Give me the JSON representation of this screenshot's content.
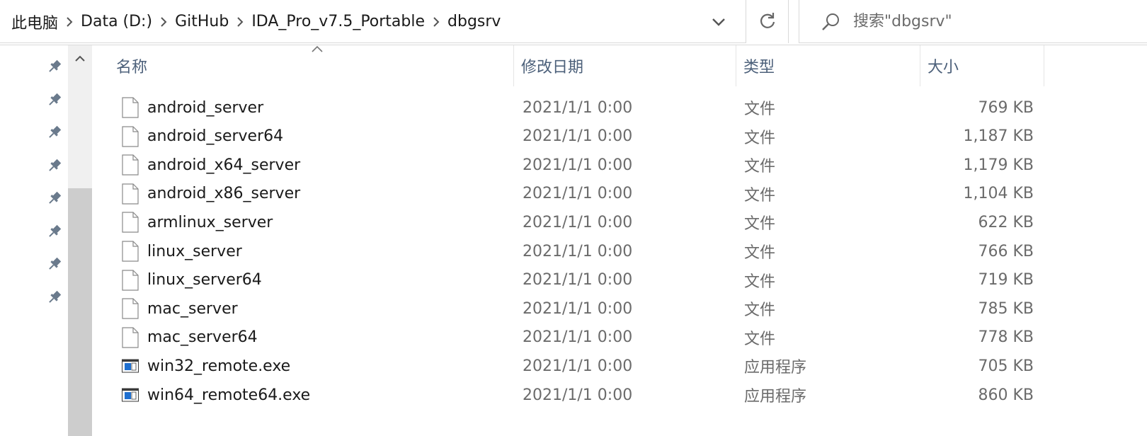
{
  "breadcrumb": [
    "此电脑",
    "Data (D:)",
    "GitHub",
    "IDA_Pro_v7.5_Portable",
    "dbgsrv"
  ],
  "search": {
    "placeholder": "搜索\"dbgsrv\""
  },
  "columns": {
    "name": "名称",
    "date": "修改日期",
    "type": "类型",
    "size": "大小"
  },
  "files": [
    {
      "name": "android_server",
      "date": "2021/1/1 0:00",
      "type": "文件",
      "size": "769 KB",
      "icon": "file-icon"
    },
    {
      "name": "android_server64",
      "date": "2021/1/1 0:00",
      "type": "文件",
      "size": "1,187 KB",
      "icon": "file-icon"
    },
    {
      "name": "android_x64_server",
      "date": "2021/1/1 0:00",
      "type": "文件",
      "size": "1,179 KB",
      "icon": "file-icon"
    },
    {
      "name": "android_x86_server",
      "date": "2021/1/1 0:00",
      "type": "文件",
      "size": "1,104 KB",
      "icon": "file-icon"
    },
    {
      "name": "armlinux_server",
      "date": "2021/1/1 0:00",
      "type": "文件",
      "size": "622 KB",
      "icon": "file-icon"
    },
    {
      "name": "linux_server",
      "date": "2021/1/1 0:00",
      "type": "文件",
      "size": "766 KB",
      "icon": "file-icon"
    },
    {
      "name": "linux_server64",
      "date": "2021/1/1 0:00",
      "type": "文件",
      "size": "719 KB",
      "icon": "file-icon"
    },
    {
      "name": "mac_server",
      "date": "2021/1/1 0:00",
      "type": "文件",
      "size": "785 KB",
      "icon": "file-icon"
    },
    {
      "name": "mac_server64",
      "date": "2021/1/1 0:00",
      "type": "文件",
      "size": "778 KB",
      "icon": "file-icon"
    },
    {
      "name": "win32_remote.exe",
      "date": "2021/1/1 0:00",
      "type": "应用程序",
      "size": "705 KB",
      "icon": "exe-icon"
    },
    {
      "name": "win64_remote64.exe",
      "date": "2021/1/1 0:00",
      "type": "应用程序",
      "size": "860 KB",
      "icon": "exe-icon"
    }
  ],
  "colors": {
    "header_text": "#4c607a",
    "exe_blue": "#1e6fd0"
  }
}
